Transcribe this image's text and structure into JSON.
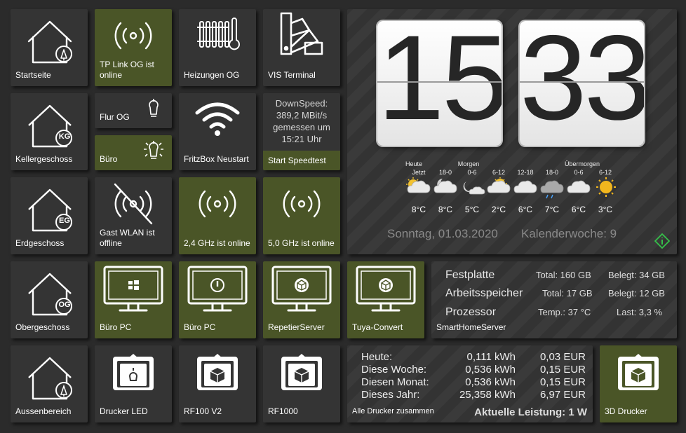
{
  "tiles": {
    "startseite": "Startseite",
    "tplink": "TP Link OG ist online",
    "heizungen": "Heizungen OG",
    "vis": "VIS Terminal",
    "keller": "Kellergeschoss",
    "flur": "Flur OG",
    "buero_light": "Büro",
    "fritzbox": "FritzBox Neustart",
    "speedtest_btn": "Start Speedtest",
    "erdgeschoss": "Erdgeschoss",
    "gast_wlan": "Gast WLAN ist offline",
    "wlan24": "2,4 GHz ist online",
    "wlan50": "5,0 GHz ist online",
    "obergeschoss": "Obergeschoss",
    "buero_pc1": "Büro PC",
    "buero_pc2": "Büro PC",
    "repetier": "RepetierServer",
    "tuya": "Tuya-Convert",
    "aussen": "Aussenbereich",
    "drucker_led": "Drucker LED",
    "rf100": "RF100 V2",
    "rf1000": "RF1000",
    "drucker3d": "3D Drucker"
  },
  "badges": {
    "kg": "KG",
    "eg": "EG",
    "og": "OG"
  },
  "speedtest": {
    "line1": "DownSpeed:",
    "line2": "389,2 MBit/s",
    "line3": "gemessen um",
    "line4": "15:21 Uhr"
  },
  "clock": {
    "hour": "15",
    "minute": "33"
  },
  "weather": {
    "day_labels": [
      "Heute",
      "Morgen",
      "Übermorgen"
    ],
    "slots": [
      {
        "time": "Jetzt",
        "icon": "partly-cloudy-sun-icon",
        "temp": "8°C"
      },
      {
        "time": "18-0",
        "icon": "partly-cloudy-night-icon",
        "temp": "8°C"
      },
      {
        "time": "0-6",
        "icon": "cloudy-night-icon",
        "temp": "5°C"
      },
      {
        "time": "6-12",
        "icon": "partly-cloudy-sun-icon",
        "temp": "2°C"
      },
      {
        "time": "12-18",
        "icon": "cloud-icon",
        "temp": "6°C"
      },
      {
        "time": "18-0",
        "icon": "rain-cloud-icon",
        "temp": "7°C"
      },
      {
        "time": "0-6",
        "icon": "cloud-icon",
        "temp": "6°C"
      },
      {
        "time": "6-12",
        "icon": "sun-icon",
        "temp": "3°C"
      }
    ],
    "date": "Sonntag, 01.03.2020",
    "week": "Kalenderwoche: 9"
  },
  "server": {
    "name": "SmartHomeServer",
    "disk_label": "Festplatte",
    "disk_total": "Total: 160 GB",
    "disk_used": "Belegt: 34 GB",
    "ram_label": "Arbeitsspeicher",
    "ram_total": "Total: 17 GB",
    "ram_used": "Belegt: 12 GB",
    "cpu_label": "Prozessor",
    "cpu_temp": "Temp.: 37 °C",
    "cpu_load": "Last: 3,3 %"
  },
  "energy": {
    "rows": [
      {
        "label": "Heute:",
        "kwh": "0,111 kWh",
        "eur": "0,03 EUR"
      },
      {
        "label": "Diese Woche:",
        "kwh": "0,536 kWh",
        "eur": "0,15 EUR"
      },
      {
        "label": "Diesen Monat:",
        "kwh": "0,536 kWh",
        "eur": "0,15 EUR"
      },
      {
        "label": "Dieses Jahr:",
        "kwh": "25,358 kWh",
        "eur": "6,97 EUR"
      }
    ],
    "footer_label": "Alle Drucker zusammen",
    "power": "Aktuelle Leistung: 1 W"
  },
  "colors": {
    "tile": "#343434",
    "active": "#4a5527",
    "background": "#2b2b2b",
    "info_icon": "#35c24a"
  }
}
